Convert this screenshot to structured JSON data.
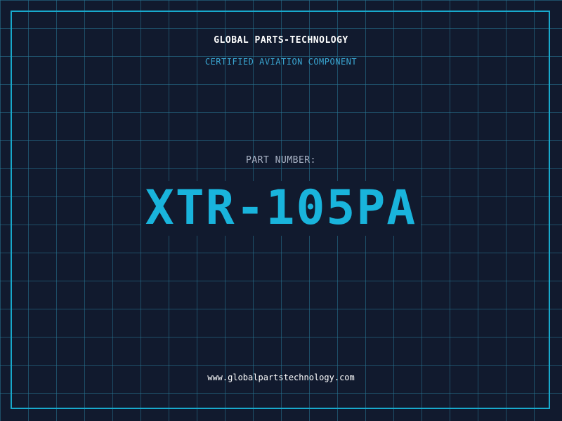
{
  "header": {
    "company": "GLOBAL PARTS-TECHNOLOGY",
    "subtitle": "CERTIFIED AVIATION COMPONENT"
  },
  "part": {
    "label": "PART NUMBER:",
    "number": "XTR-105PA"
  },
  "footer": {
    "url": "www.globalpartstechnology.com"
  },
  "colors": {
    "background": "#111a2e",
    "grid": "#28788f",
    "accent": "#18a9cc",
    "label": "#aab4c6",
    "text": "#ffffff"
  }
}
